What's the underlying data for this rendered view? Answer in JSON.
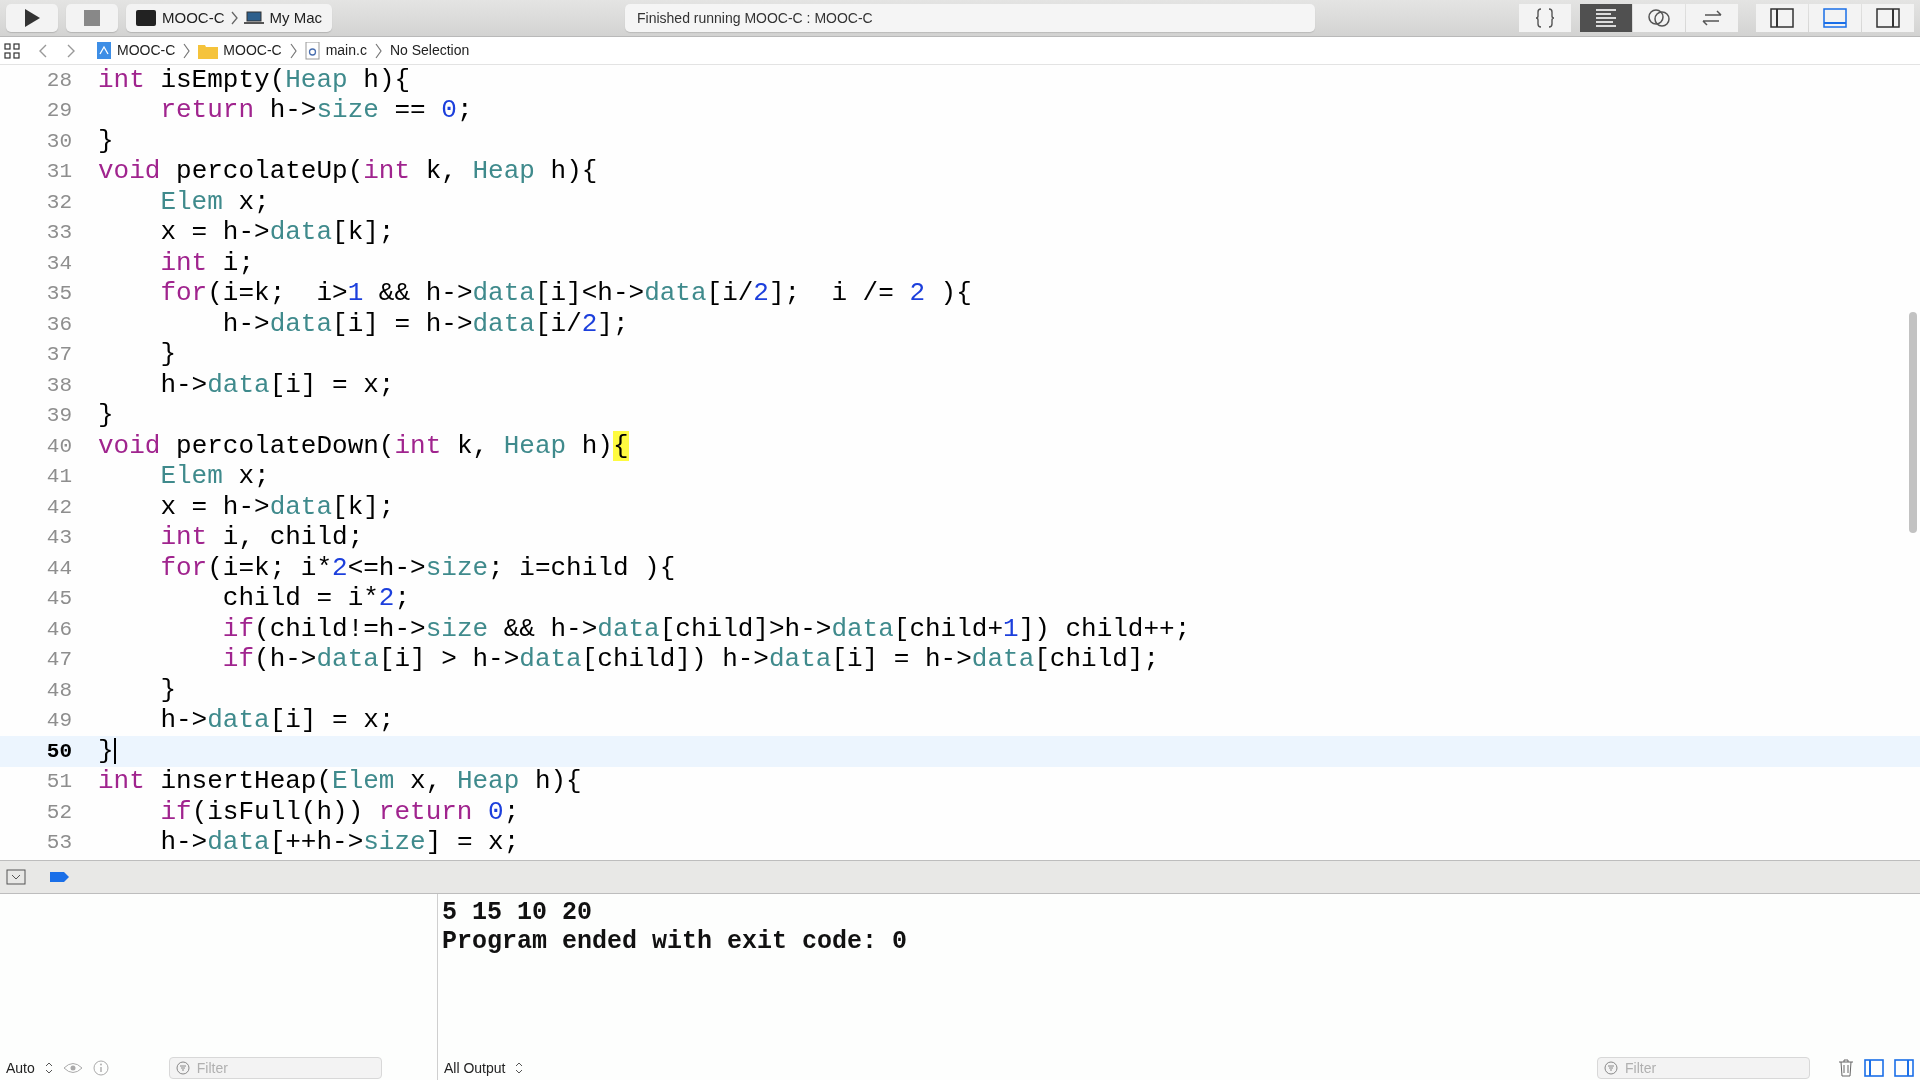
{
  "toolbar": {
    "scheme": "MOOC-C",
    "destination": "My Mac",
    "status": "Finished running MOOC-C : MOOC-C",
    "editor_modes": [
      {
        "selected": false
      },
      {
        "selected": true
      },
      {
        "selected": false
      },
      {
        "selected": false
      }
    ],
    "panels": [
      {
        "selected": false
      },
      {
        "selected": true
      },
      {
        "selected": false
      }
    ]
  },
  "breadcrumb": [
    {
      "kind": "project",
      "label": "MOOC-C"
    },
    {
      "kind": "folder",
      "label": "MOOC-C"
    },
    {
      "kind": "file",
      "label": "main.c"
    },
    {
      "kind": "none",
      "label": "No Selection"
    }
  ],
  "editor": {
    "lines": [
      {
        "number": "28",
        "current": false,
        "tokens": [
          {
            "kind": "kw",
            "text": "int"
          },
          {
            "kind": "p",
            "text": " isEmpty("
          },
          {
            "kind": "type",
            "text": "Heap"
          },
          {
            "kind": "p",
            "text": " h){"
          }
        ]
      },
      {
        "number": "29",
        "current": false,
        "tokens": [
          {
            "kind": "kw",
            "text": "    return"
          },
          {
            "kind": "p",
            "text": " h->"
          },
          {
            "kind": "member",
            "text": "size"
          },
          {
            "kind": "p",
            "text": " == "
          },
          {
            "kind": "num",
            "text": "0"
          },
          {
            "kind": "p",
            "text": ";"
          }
        ]
      },
      {
        "number": "30",
        "current": false,
        "tokens": [
          {
            "kind": "p",
            "text": "}"
          }
        ]
      },
      {
        "number": "31",
        "current": false,
        "tokens": [
          {
            "kind": "kw",
            "text": "void"
          },
          {
            "kind": "p",
            "text": " percolateUp("
          },
          {
            "kind": "kw",
            "text": "int"
          },
          {
            "kind": "p",
            "text": " k, "
          },
          {
            "kind": "type",
            "text": "Heap"
          },
          {
            "kind": "p",
            "text": " h){"
          }
        ]
      },
      {
        "number": "32",
        "current": false,
        "tokens": [
          {
            "kind": "type",
            "text": "    Elem"
          },
          {
            "kind": "p",
            "text": " x;"
          }
        ]
      },
      {
        "number": "33",
        "current": false,
        "tokens": [
          {
            "kind": "p",
            "text": "    x = h->"
          },
          {
            "kind": "member",
            "text": "data"
          },
          {
            "kind": "p",
            "text": "[k];"
          }
        ]
      },
      {
        "number": "34",
        "current": false,
        "tokens": [
          {
            "kind": "kw",
            "text": "    int"
          },
          {
            "kind": "p",
            "text": " i;"
          }
        ]
      },
      {
        "number": "35",
        "current": false,
        "tokens": [
          {
            "kind": "kw",
            "text": "    for"
          },
          {
            "kind": "p",
            "text": "(i=k;  i>"
          },
          {
            "kind": "num",
            "text": "1"
          },
          {
            "kind": "p",
            "text": " && h->"
          },
          {
            "kind": "member",
            "text": "data"
          },
          {
            "kind": "p",
            "text": "[i]<h->"
          },
          {
            "kind": "member",
            "text": "data"
          },
          {
            "kind": "p",
            "text": "[i/"
          },
          {
            "kind": "num",
            "text": "2"
          },
          {
            "kind": "p",
            "text": "];  i /= "
          },
          {
            "kind": "num",
            "text": "2"
          },
          {
            "kind": "p",
            "text": " ){"
          }
        ]
      },
      {
        "number": "36",
        "current": false,
        "tokens": [
          {
            "kind": "p",
            "text": "        h->"
          },
          {
            "kind": "member",
            "text": "data"
          },
          {
            "kind": "p",
            "text": "[i] = h->"
          },
          {
            "kind": "member",
            "text": "data"
          },
          {
            "kind": "p",
            "text": "[i/"
          },
          {
            "kind": "num",
            "text": "2"
          },
          {
            "kind": "p",
            "text": "];"
          }
        ]
      },
      {
        "number": "37",
        "current": false,
        "tokens": [
          {
            "kind": "p",
            "text": "    }"
          }
        ]
      },
      {
        "number": "38",
        "current": false,
        "tokens": [
          {
            "kind": "p",
            "text": "    h->"
          },
          {
            "kind": "member",
            "text": "data"
          },
          {
            "kind": "p",
            "text": "[i] = x;"
          }
        ]
      },
      {
        "number": "39",
        "current": false,
        "tokens": [
          {
            "kind": "p",
            "text": "}"
          }
        ]
      },
      {
        "number": "40",
        "current": false,
        "tokens": [
          {
            "kind": "kw",
            "text": "void"
          },
          {
            "kind": "p",
            "text": " percolateDown("
          },
          {
            "kind": "kw",
            "text": "int"
          },
          {
            "kind": "p",
            "text": " k, "
          },
          {
            "kind": "type",
            "text": "Heap"
          },
          {
            "kind": "p",
            "text": " h)"
          },
          {
            "kind": "match",
            "text": "{"
          }
        ]
      },
      {
        "number": "41",
        "current": false,
        "tokens": [
          {
            "kind": "type",
            "text": "    Elem"
          },
          {
            "kind": "p",
            "text": " x;"
          }
        ]
      },
      {
        "number": "42",
        "current": false,
        "tokens": [
          {
            "kind": "p",
            "text": "    x = h->"
          },
          {
            "kind": "member",
            "text": "data"
          },
          {
            "kind": "p",
            "text": "[k];"
          }
        ]
      },
      {
        "number": "43",
        "current": false,
        "tokens": [
          {
            "kind": "kw",
            "text": "    int"
          },
          {
            "kind": "p",
            "text": " i, child;"
          }
        ]
      },
      {
        "number": "44",
        "current": false,
        "tokens": [
          {
            "kind": "kw",
            "text": "    for"
          },
          {
            "kind": "p",
            "text": "(i=k; i*"
          },
          {
            "kind": "num",
            "text": "2"
          },
          {
            "kind": "p",
            "text": "<=h->"
          },
          {
            "kind": "member",
            "text": "size"
          },
          {
            "kind": "p",
            "text": "; i=child ){"
          }
        ]
      },
      {
        "number": "45",
        "current": false,
        "tokens": [
          {
            "kind": "p",
            "text": "        child = i*"
          },
          {
            "kind": "num",
            "text": "2"
          },
          {
            "kind": "p",
            "text": ";"
          }
        ]
      },
      {
        "number": "46",
        "current": false,
        "tokens": [
          {
            "kind": "kw",
            "text": "        if"
          },
          {
            "kind": "p",
            "text": "(child!=h->"
          },
          {
            "kind": "member",
            "text": "size"
          },
          {
            "kind": "p",
            "text": " && h->"
          },
          {
            "kind": "member",
            "text": "data"
          },
          {
            "kind": "p",
            "text": "[child]>h->"
          },
          {
            "kind": "member",
            "text": "data"
          },
          {
            "kind": "p",
            "text": "[child+"
          },
          {
            "kind": "num",
            "text": "1"
          },
          {
            "kind": "p",
            "text": "]) child++;"
          }
        ]
      },
      {
        "number": "47",
        "current": false,
        "tokens": [
          {
            "kind": "kw",
            "text": "        if"
          },
          {
            "kind": "p",
            "text": "(h->"
          },
          {
            "kind": "member",
            "text": "data"
          },
          {
            "kind": "p",
            "text": "[i] > h->"
          },
          {
            "kind": "member",
            "text": "data"
          },
          {
            "kind": "p",
            "text": "[child]) h->"
          },
          {
            "kind": "member",
            "text": "data"
          },
          {
            "kind": "p",
            "text": "[i] = h->"
          },
          {
            "kind": "member",
            "text": "data"
          },
          {
            "kind": "p",
            "text": "[child];"
          }
        ]
      },
      {
        "number": "48",
        "current": false,
        "tokens": [
          {
            "kind": "p",
            "text": "    }"
          }
        ]
      },
      {
        "number": "49",
        "current": false,
        "tokens": [
          {
            "kind": "p",
            "text": "    h->"
          },
          {
            "kind": "member",
            "text": "data"
          },
          {
            "kind": "p",
            "text": "[i] = x;"
          }
        ]
      },
      {
        "number": "50",
        "current": true,
        "tokens": [
          {
            "kind": "p",
            "text": "}"
          }
        ]
      },
      {
        "number": "51",
        "current": false,
        "tokens": [
          {
            "kind": "kw",
            "text": "int"
          },
          {
            "kind": "p",
            "text": " insertHeap("
          },
          {
            "kind": "type",
            "text": "Elem"
          },
          {
            "kind": "p",
            "text": " x, "
          },
          {
            "kind": "type",
            "text": "Heap"
          },
          {
            "kind": "p",
            "text": " h){"
          }
        ]
      },
      {
        "number": "52",
        "current": false,
        "tokens": [
          {
            "kind": "kw",
            "text": "    if"
          },
          {
            "kind": "p",
            "text": "(isFull(h)) "
          },
          {
            "kind": "kw",
            "text": "return"
          },
          {
            "kind": "num",
            "text": " 0"
          },
          {
            "kind": "p",
            "text": ";"
          }
        ]
      },
      {
        "number": "53",
        "current": false,
        "tokens": [
          {
            "kind": "p",
            "text": "    h->"
          },
          {
            "kind": "member",
            "text": "data"
          },
          {
            "kind": "p",
            "text": "[++h->"
          },
          {
            "kind": "member",
            "text": "size"
          },
          {
            "kind": "p",
            "text": "] = x;"
          }
        ]
      }
    ]
  },
  "debug_bar": {
    "breakpoints_active": true
  },
  "console": {
    "variables_scope": "Auto",
    "variables_filter": {
      "placeholder": "Filter"
    },
    "output": [
      "5 15 10 20",
      "Program ended with exit code: 0"
    ],
    "output_scope": "All Output",
    "output_filter": {
      "placeholder": "Filter"
    }
  }
}
